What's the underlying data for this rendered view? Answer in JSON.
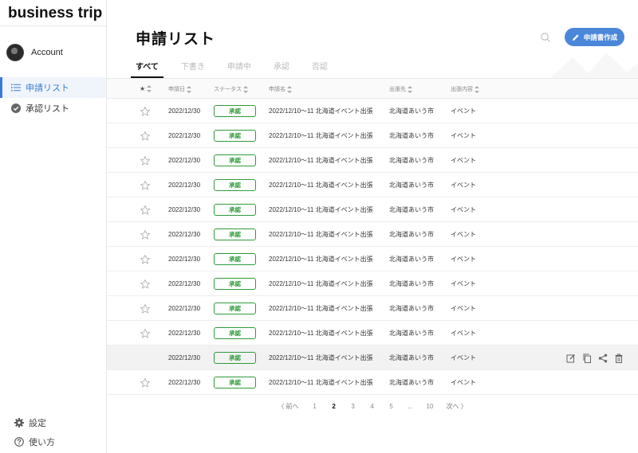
{
  "app": {
    "brand": "business trip"
  },
  "sidebar": {
    "account_label": "Account",
    "items": [
      {
        "label": "申請リスト",
        "icon": "list-icon",
        "active": true
      },
      {
        "label": "承認リスト",
        "icon": "check-circle-icon",
        "active": false
      }
    ],
    "bottom_items": [
      {
        "label": "設定",
        "icon": "gear-icon"
      },
      {
        "label": "使い方",
        "icon": "help-icon"
      }
    ]
  },
  "header": {
    "title": "申請リスト",
    "create_button": "申請書作成"
  },
  "tabs": [
    "すべて",
    "下書き",
    "申請中",
    "承認",
    "否認"
  ],
  "table": {
    "columns": {
      "date": "申請日",
      "status": "ステータス",
      "name": "申請名",
      "destination": "出張先",
      "content": "出張内容"
    },
    "rows": [
      {
        "date": "2022/12/30",
        "status": "承認",
        "name": "2022/12/10〜11 北海道イベント出張",
        "destination": "北海道あいう市",
        "content": "イベント"
      },
      {
        "date": "2022/12/30",
        "status": "承認",
        "name": "2022/12/10〜11 北海道イベント出張",
        "destination": "北海道あいう市",
        "content": "イベント"
      },
      {
        "date": "2022/12/30",
        "status": "承認",
        "name": "2022/12/10〜11 北海道イベント出張",
        "destination": "北海道あいう市",
        "content": "イベント"
      },
      {
        "date": "2022/12/30",
        "status": "承認",
        "name": "2022/12/10〜11 北海道イベント出張",
        "destination": "北海道あいう市",
        "content": "イベント"
      },
      {
        "date": "2022/12/30",
        "status": "承認",
        "name": "2022/12/10〜11 北海道イベント出張",
        "destination": "北海道あいう市",
        "content": "イベント"
      },
      {
        "date": "2022/12/30",
        "status": "承認",
        "name": "2022/12/10〜11 北海道イベント出張",
        "destination": "北海道あいう市",
        "content": "イベント"
      },
      {
        "date": "2022/12/30",
        "status": "承認",
        "name": "2022/12/10〜11 北海道イベント出張",
        "destination": "北海道あいう市",
        "content": "イベント"
      },
      {
        "date": "2022/12/30",
        "status": "承認",
        "name": "2022/12/10〜11 北海道イベント出張",
        "destination": "北海道あいう市",
        "content": "イベント"
      },
      {
        "date": "2022/12/30",
        "status": "承認",
        "name": "2022/12/10〜11 北海道イベント出張",
        "destination": "北海道あいう市",
        "content": "イベント"
      },
      {
        "date": "2022/12/30",
        "status": "承認",
        "name": "2022/12/10〜11 北海道イベント出張",
        "destination": "北海道あいう市",
        "content": "イベント"
      },
      {
        "date": "2022/12/30",
        "status": "承認",
        "name": "2022/12/10〜11 北海道イベント出張",
        "destination": "北海道あいう市",
        "content": "イベント"
      },
      {
        "date": "2022/12/30",
        "status": "承認",
        "name": "2022/12/10〜11 北海道イベント出張",
        "destination": "北海道あいう市",
        "content": "イベント"
      }
    ],
    "hover_row_index": 10
  },
  "pagination": {
    "prev": "〈 前へ",
    "next": "次へ 〉",
    "pages": [
      "1",
      "2",
      "3",
      "4",
      "5",
      "...",
      "10"
    ],
    "current": "2"
  },
  "colors": {
    "accent": "#4a87d8",
    "status_green": "#2e9b3a",
    "active_nav": "#3a7bd5"
  }
}
